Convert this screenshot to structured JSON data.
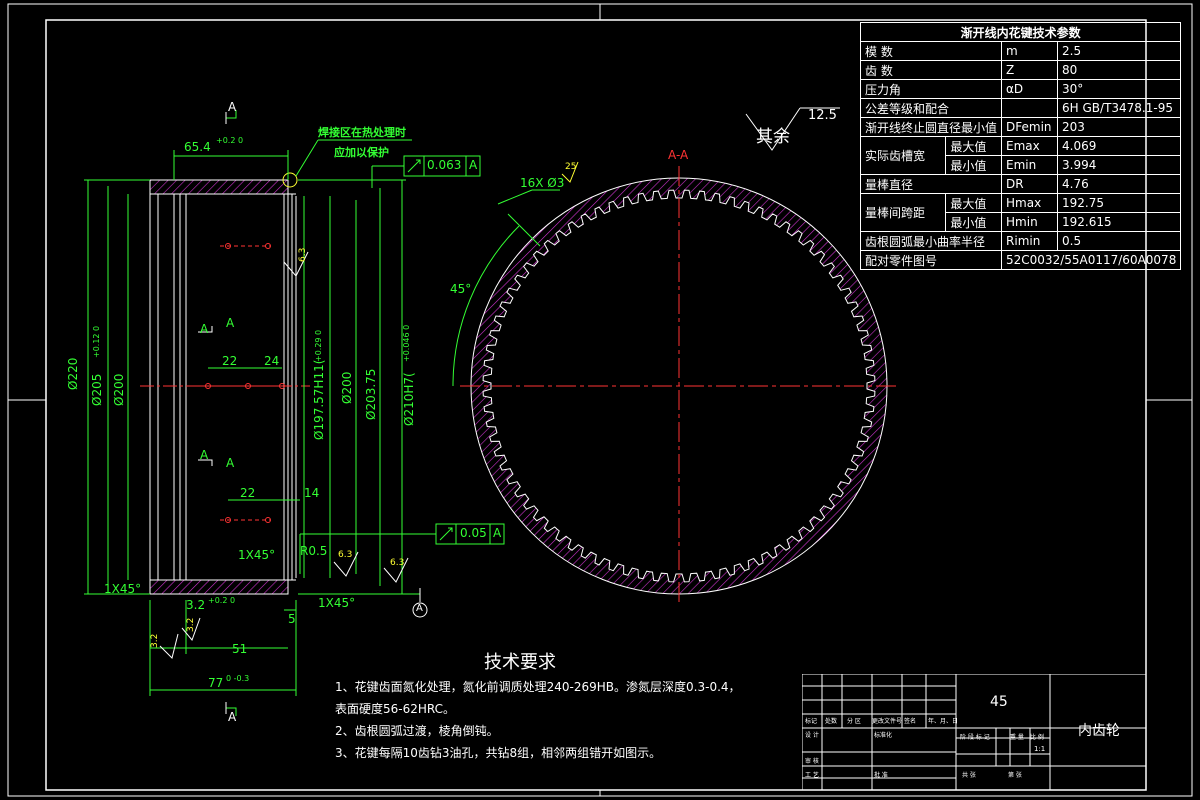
{
  "params_table": {
    "title": "渐开线内花键技术参数",
    "rows": [
      {
        "name": "模  数",
        "symbol": "m",
        "value": "2.5"
      },
      {
        "name": "齿  数",
        "symbol": "Z",
        "value": "80"
      },
      {
        "name": "压力角",
        "symbol": "αD",
        "value": "30°"
      },
      {
        "name": "公差等级和配合",
        "symbol": "",
        "value": "6H GB/T3478.1-95"
      },
      {
        "name": "渐开线终止圆直径最小值",
        "symbol": "DFemin",
        "value": "203"
      },
      {
        "name": "实际齿槽宽",
        "sub": "最大值",
        "symbol": "Emax",
        "value": "4.069"
      },
      {
        "name": "",
        "sub": "最小值",
        "symbol": "Emin",
        "value": "3.994"
      },
      {
        "name": "量棒直径",
        "symbol": "DR",
        "value": "4.76"
      },
      {
        "name": "量棒间跨距",
        "sub": "最大值",
        "symbol": "Hmax",
        "value": "192.75"
      },
      {
        "name": "",
        "sub": "最小值",
        "symbol": "Hmin",
        "value": "192.615"
      },
      {
        "name": "齿根圆弧最小曲率半径",
        "symbol": "Rimin",
        "value": "0.5"
      },
      {
        "name": "配对零件图号",
        "symbol": "",
        "value": "52C0032/55A0117/60A0078"
      }
    ]
  },
  "remainder": {
    "label": "其余",
    "roughness": "12.5"
  },
  "section_view": {
    "label": "A-A",
    "holes": "16X Ø3",
    "angle": "45°",
    "depth": "25",
    "tooth_count": 80
  },
  "side_view": {
    "notes": [
      "焊接区在热处理时",
      "应加以保护"
    ],
    "dims": {
      "top_width": "65.4",
      "top_width_tol": "+0.2 0",
      "d220": "Ø220",
      "d205": "Ø205",
      "d205_tol": "+0.12 0",
      "d200": "Ø200",
      "d197": "Ø197.57H11(",
      "d197_tol": "+0.29 0",
      "d200b": "Ø200",
      "d203": "Ø203.75",
      "d210": "Ø210H7(",
      "d210_tol": "+0.046 0",
      "w22a": "22",
      "w24": "24",
      "w22b": "22",
      "w14": "14",
      "bottom32": "3.2",
      "bottom32_tol": "+0.2 0",
      "bottom5": "5",
      "bottom51": "51",
      "bottom77": "77",
      "bottom77_tol": "0 -0.3",
      "chamfer_left": "1X45°",
      "chamfer_mid": "1X45°",
      "chamfer_right": "1X45°",
      "r05": "R0.5"
    },
    "tol_frames": [
      {
        "value": "0.063",
        "datum": "A"
      },
      {
        "value": "0.05",
        "datum": "A"
      }
    ],
    "section_marks": [
      "A",
      "A",
      "A",
      "A",
      "A",
      "A"
    ],
    "roughness": [
      "6.3",
      "6.3",
      "6.3",
      "3.2",
      "3.2"
    ],
    "datum": "A"
  },
  "tech_requirements": {
    "title": "技术要求",
    "items": [
      "1、花键齿面氮化处理，氮化前调质处理240-269HB。渗氮层深度0.3-0.4，",
      "表面硬度56-62HRC。",
      "2、齿根圆弧过渡，棱角倒钝。",
      "3、花键每隔10齿钻3油孔，共钻8组，相邻两组错开如图示。"
    ]
  },
  "title_block": {
    "material": "45",
    "part_name": "内齿轮",
    "scale": "1:1",
    "cells": [
      "标记",
      "处数",
      "分 区",
      "更改文件号",
      "签名",
      "年、月、日",
      "设 计",
      "标准化",
      "阶 段 标 记",
      "重 量",
      "比 例",
      "审 核",
      "工 艺",
      "批 准",
      "共 张",
      "第 张"
    ]
  },
  "colors": {
    "green": "#33ff33",
    "magenta": "#cc33cc",
    "red": "#ff3333",
    "yellow": "#ffff33",
    "white": "#ffffff"
  }
}
